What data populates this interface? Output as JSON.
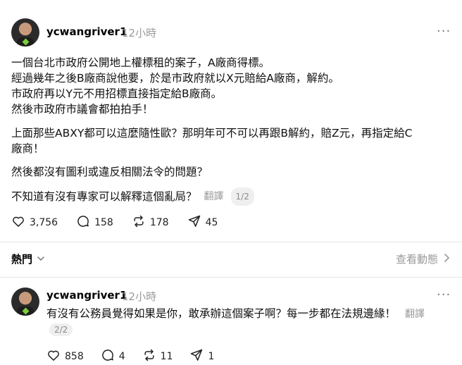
{
  "post": {
    "username": "ycwangriver1",
    "time": "12小時",
    "more": "···",
    "paragraphs": [
      "一個台北市政府公開地上權標租的案子，A廠商得標。",
      "經過幾年之後B廠商說他要，於是市政府就以X元賠給A廠商，解約。",
      "市政府再以Y元不用招標直接指定給B廠商。",
      "然後市政府市議會都拍拍手！",
      "上面那些ABXY都可以這麼隨性歐？那明年可不可以再跟B解約，賠Z元，再指定給C",
      "廠商！",
      "然後都沒有圖利或違反相關法令的問題？",
      "不知道有沒有專家可以解釋這個亂局？"
    ],
    "translate": "翻譯",
    "page_indicator": "1/2",
    "stats": {
      "likes": "3,756",
      "comments": "158",
      "reposts": "178",
      "shares": "45"
    }
  },
  "replies_bar": {
    "sort_label": "熱門",
    "activity_label": "查看動態"
  },
  "reply": {
    "username": "ycwangriver1",
    "time": "12小時",
    "more": "···",
    "text": "有沒有公務員覺得如果是你，敢承辦這個案子啊？每一步都在法規邊緣！",
    "translate": "翻譯",
    "page_indicator": "2/2",
    "stats": {
      "likes": "858",
      "comments": "4",
      "reposts": "11",
      "shares": "1"
    }
  },
  "icons": [
    "heart-icon",
    "comment-icon",
    "repost-icon",
    "share-icon",
    "more-icon",
    "chevron-down-icon",
    "chevron-right-icon"
  ]
}
